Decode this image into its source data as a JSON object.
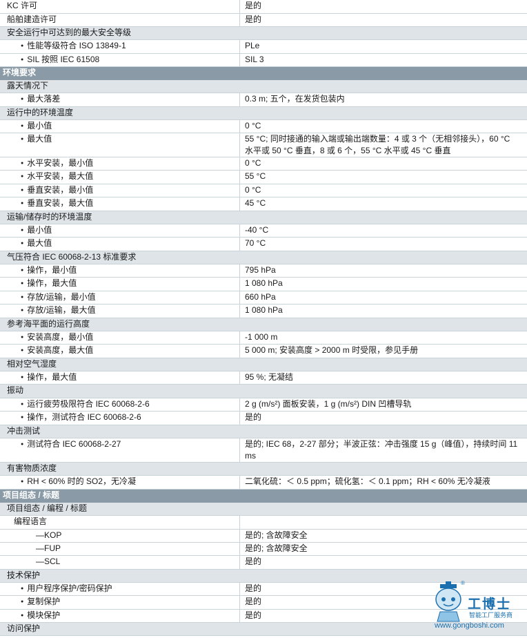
{
  "rows": [
    {
      "kind": "item",
      "label": "KC 许可",
      "value": "是的",
      "h": 20
    },
    {
      "kind": "item",
      "label": "船舶建造许可",
      "value": "是的",
      "h": 19
    },
    {
      "kind": "hdr",
      "label": "安全运行中可达到的最大安全等级",
      "value": "",
      "h": 19
    },
    {
      "kind": "bul",
      "label": "性能等级符合 ISO 13849-1",
      "value": "PLe",
      "h": 20
    },
    {
      "kind": "bul",
      "label": "SIL 按照 IEC 61508",
      "value": "SIL 3",
      "h": 19
    },
    {
      "kind": "sec",
      "label": "环境要求",
      "value": "",
      "h": 19
    },
    {
      "kind": "hdr",
      "label": "露天情况下",
      "value": "",
      "h": 19
    },
    {
      "kind": "bul",
      "label": "最大落差",
      "value": "0.3 m; 五个，在发货包装内",
      "h": 20
    },
    {
      "kind": "hdr",
      "label": "运行中的环境温度",
      "value": "",
      "h": 19
    },
    {
      "kind": "bul",
      "label": "最小值",
      "value": "0 °C",
      "h": 19
    },
    {
      "kind": "bul",
      "label": "最大值",
      "value": "55 °C; 同时接通的输入端或输出端数量：4 或 3 个（无相邻接头），60 °C 水平或 50 °C 垂直，8 或 6 个，55 °C 水平或 45 °C 垂直",
      "h": 35
    },
    {
      "kind": "bul",
      "label": "水平安装，最小值",
      "value": "0 °C",
      "h": 19
    },
    {
      "kind": "bul",
      "label": "水平安装，最大值",
      "value": "55 °C",
      "h": 20
    },
    {
      "kind": "bul",
      "label": "垂直安装，最小值",
      "value": "0 °C",
      "h": 19
    },
    {
      "kind": "bul",
      "label": "垂直安装，最大值",
      "value": "45 °C",
      "h": 20
    },
    {
      "kind": "hdr",
      "label": "运输/储存时的环境温度",
      "value": "",
      "h": 19
    },
    {
      "kind": "bul",
      "label": "最小值",
      "value": "-40 °C",
      "h": 19
    },
    {
      "kind": "bul",
      "label": "最大值",
      "value": "70 °C",
      "h": 20
    },
    {
      "kind": "hdr",
      "label": "气压符合 IEC 60068-2-13 标准要求",
      "value": "",
      "h": 19
    },
    {
      "kind": "bul",
      "label": "操作，最小值",
      "value": "795 hPa",
      "h": 19
    },
    {
      "kind": "bul",
      "label": "操作，最大值",
      "value": "1 080 hPa",
      "h": 20
    },
    {
      "kind": "bul",
      "label": "存放/运输，最小值",
      "value": "660 hPa",
      "h": 19
    },
    {
      "kind": "bul",
      "label": "存放/运输，最大值",
      "value": "1 080 hPa",
      "h": 20
    },
    {
      "kind": "hdr",
      "label": "参考海平面的运行高度",
      "value": "",
      "h": 19
    },
    {
      "kind": "bul",
      "label": "安装高度，最小值",
      "value": "-1 000 m",
      "h": 19
    },
    {
      "kind": "bul",
      "label": "安装高度，最大值",
      "value": "5 000 m; 安装高度 > 2000 m 时受限，参见手册",
      "h": 20
    },
    {
      "kind": "hdr",
      "label": "相对空气湿度",
      "value": "",
      "h": 19
    },
    {
      "kind": "bul",
      "label": "操作，最大值",
      "value": "95 %; 无凝结",
      "h": 19
    },
    {
      "kind": "hdr",
      "label": "振动",
      "value": "",
      "h": 20
    },
    {
      "kind": "bul",
      "label": "运行疲劳极限符合 IEC 60068-2-6",
      "value": "2 g (m/s²) 面板安装，1 g (m/s²) DIN 凹槽导轨",
      "h": 19
    },
    {
      "kind": "bul",
      "label": "操作，测试符合 IEC 60068-2-6",
      "value": "是的",
      "h": 20
    },
    {
      "kind": "hdr",
      "label": "冲击测试",
      "value": "",
      "h": 19
    },
    {
      "kind": "bul",
      "label": "测试符合 IEC 60068-2-27",
      "value": "是的; IEC 68，2-27 部分；半波正弦：冲击强度 15 g（峰值），持续时间 11 ms",
      "h": 35
    },
    {
      "kind": "hdr",
      "label": "有害物质浓度",
      "value": "",
      "h": 19
    },
    {
      "kind": "bul",
      "label": "RH < 60% 时的 SO2，无冷凝",
      "value": "二氧化硫：＜ 0.5 ppm；硫化氢：＜ 0.1 ppm；RH < 60% 无冷凝液",
      "h": 20
    },
    {
      "kind": "sec",
      "label": "项目组态 / 标题",
      "value": "",
      "h": 19
    },
    {
      "kind": "hdr",
      "label": "项目组态 / 编程 / 标题",
      "value": "",
      "h": 19
    },
    {
      "kind": "sub1",
      "label": "编程语言",
      "value": "",
      "h": 20
    },
    {
      "kind": "dash",
      "label": "KOP",
      "value": "是的; 含故障安全",
      "h": 19
    },
    {
      "kind": "dash",
      "label": "FUP",
      "value": "是的; 含故障安全",
      "h": 19
    },
    {
      "kind": "dash",
      "label": "SCL",
      "value": "是的",
      "h": 20
    },
    {
      "kind": "hdr",
      "label": "技术保护",
      "value": "",
      "h": 19
    },
    {
      "kind": "bul",
      "label": "用户程序保护/密码保护",
      "value": "是的",
      "h": 19
    },
    {
      "kind": "bul",
      "label": "复制保护",
      "value": "是的",
      "h": 20
    },
    {
      "kind": "bul",
      "label": "模块保护",
      "value": "是的",
      "h": 19
    },
    {
      "kind": "hdr",
      "label": "访问保护",
      "value": "",
      "h": 19
    }
  ],
  "watermark": {
    "brand": "工博士",
    "tagline": "智能工厂服务商",
    "url": "www.gongboshi.com",
    "reg": "®",
    "icon": "robot-mascot-icon"
  },
  "colors": {
    "section_bg": "#8a9aa6",
    "header_bg": "#dfe4e8",
    "border": "#c9d3da",
    "brand": "#1b6fae"
  }
}
